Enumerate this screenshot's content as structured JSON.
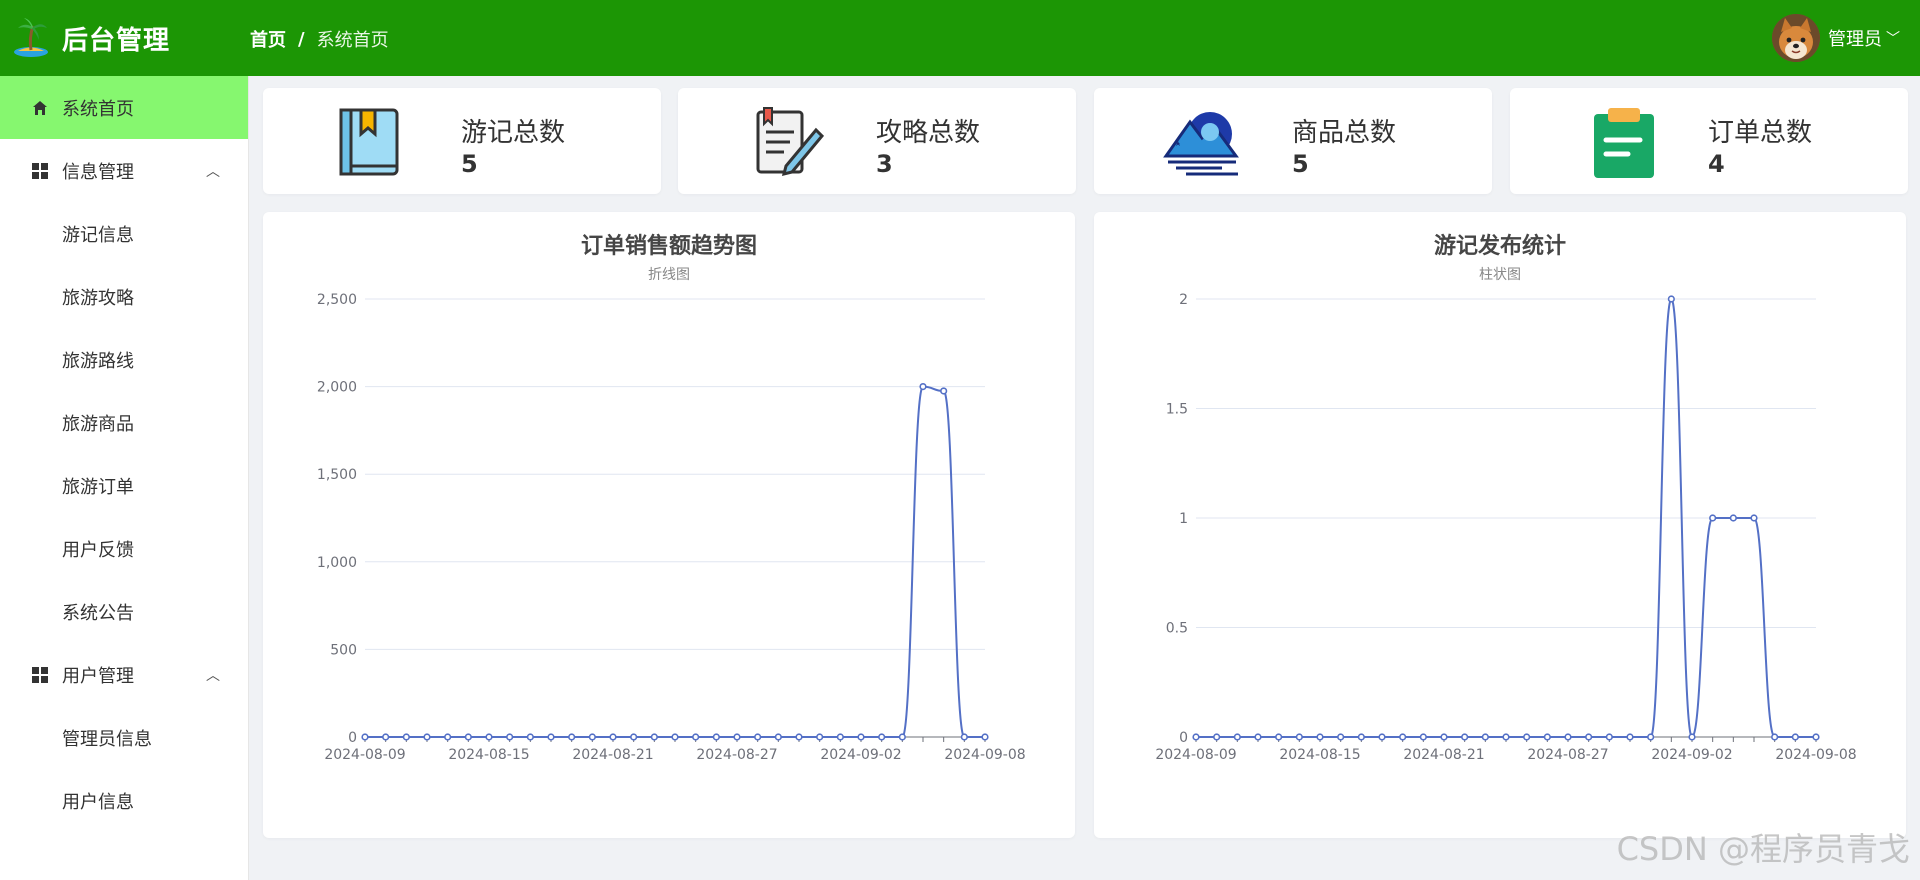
{
  "header": {
    "app_title": "后台管理",
    "breadcrumb_home": "首页",
    "breadcrumb_sep": "/",
    "breadcrumb_current": "系统首页",
    "user_name": "管理员",
    "user_caret": "﹀",
    "bg_color": "#1c9605"
  },
  "sidebar": {
    "items": [
      {
        "label": "系统首页",
        "icon": "home-icon",
        "active": true
      },
      {
        "label": "信息管理",
        "icon": "grid-icon",
        "arrow": "︿"
      },
      {
        "label": "游记信息"
      },
      {
        "label": "旅游攻略"
      },
      {
        "label": "旅游路线"
      },
      {
        "label": "旅游商品"
      },
      {
        "label": "旅游订单"
      },
      {
        "label": "用户反馈"
      },
      {
        "label": "系统公告"
      },
      {
        "label": "用户管理",
        "icon": "grid-icon",
        "arrow": "︿"
      },
      {
        "label": "管理员信息"
      },
      {
        "label": "用户信息"
      }
    ],
    "active_color": "#86f76f"
  },
  "stats": [
    {
      "label": "游记总数",
      "value": "5",
      "icon": "book-icon"
    },
    {
      "label": "攻略总数",
      "value": "3",
      "icon": "notepad-pen-icon"
    },
    {
      "label": "商品总数",
      "value": "5",
      "icon": "mountain-icon"
    },
    {
      "label": "订单总数",
      "value": "4",
      "icon": "clipboard-icon"
    }
  ],
  "chart_data": [
    {
      "type": "line",
      "title": "订单销售额趋势图",
      "subtitle": "折线图",
      "x_tick_labels": [
        "2024-08-09",
        "2024-08-15",
        "2024-08-21",
        "2024-08-27",
        "2024-09-02",
        "2024-09-08"
      ],
      "y_tick_labels": [
        "0",
        "500",
        "1,000",
        "1,500",
        "2,000",
        "2,500"
      ],
      "ylim": [
        0,
        2500
      ],
      "x": [
        "2024-08-09",
        "2024-08-10",
        "2024-08-11",
        "2024-08-12",
        "2024-08-13",
        "2024-08-14",
        "2024-08-15",
        "2024-08-16",
        "2024-08-17",
        "2024-08-18",
        "2024-08-19",
        "2024-08-20",
        "2024-08-21",
        "2024-08-22",
        "2024-08-23",
        "2024-08-24",
        "2024-08-25",
        "2024-08-26",
        "2024-08-27",
        "2024-08-28",
        "2024-08-29",
        "2024-08-30",
        "2024-08-31",
        "2024-09-01",
        "2024-09-02",
        "2024-09-03",
        "2024-09-04",
        "2024-09-05",
        "2024-09-06",
        "2024-09-07",
        "2024-09-08"
      ],
      "series": [
        {
          "values": [
            0,
            0,
            0,
            0,
            0,
            0,
            0,
            0,
            0,
            0,
            0,
            0,
            0,
            0,
            0,
            0,
            0,
            0,
            0,
            0,
            0,
            0,
            0,
            0,
            0,
            0,
            0,
            2000,
            1975,
            0,
            0
          ],
          "color": "#5470c6"
        }
      ],
      "grid": true
    },
    {
      "type": "line",
      "title": "游记发布统计",
      "subtitle": "柱状图",
      "x_tick_labels": [
        "2024-08-09",
        "2024-08-15",
        "2024-08-21",
        "2024-08-27",
        "2024-09-02",
        "2024-09-08"
      ],
      "y_tick_labels": [
        "0",
        "0.5",
        "1",
        "1.5",
        "2"
      ],
      "ylim": [
        0,
        2
      ],
      "x": [
        "2024-08-09",
        "2024-08-10",
        "2024-08-11",
        "2024-08-12",
        "2024-08-13",
        "2024-08-14",
        "2024-08-15",
        "2024-08-16",
        "2024-08-17",
        "2024-08-18",
        "2024-08-19",
        "2024-08-20",
        "2024-08-21",
        "2024-08-22",
        "2024-08-23",
        "2024-08-24",
        "2024-08-25",
        "2024-08-26",
        "2024-08-27",
        "2024-08-28",
        "2024-08-29",
        "2024-08-30",
        "2024-08-31",
        "2024-09-01",
        "2024-09-02",
        "2024-09-03",
        "2024-09-04",
        "2024-09-05",
        "2024-09-06",
        "2024-09-07",
        "2024-09-08"
      ],
      "series": [
        {
          "values": [
            0,
            0,
            0,
            0,
            0,
            0,
            0,
            0,
            0,
            0,
            0,
            0,
            0,
            0,
            0,
            0,
            0,
            0,
            0,
            0,
            0,
            0,
            0,
            2,
            0,
            1,
            1,
            1,
            0,
            0,
            0
          ],
          "color": "#5470c6"
        }
      ],
      "grid": true
    }
  ],
  "watermark": "CSDN @程序员青戈"
}
